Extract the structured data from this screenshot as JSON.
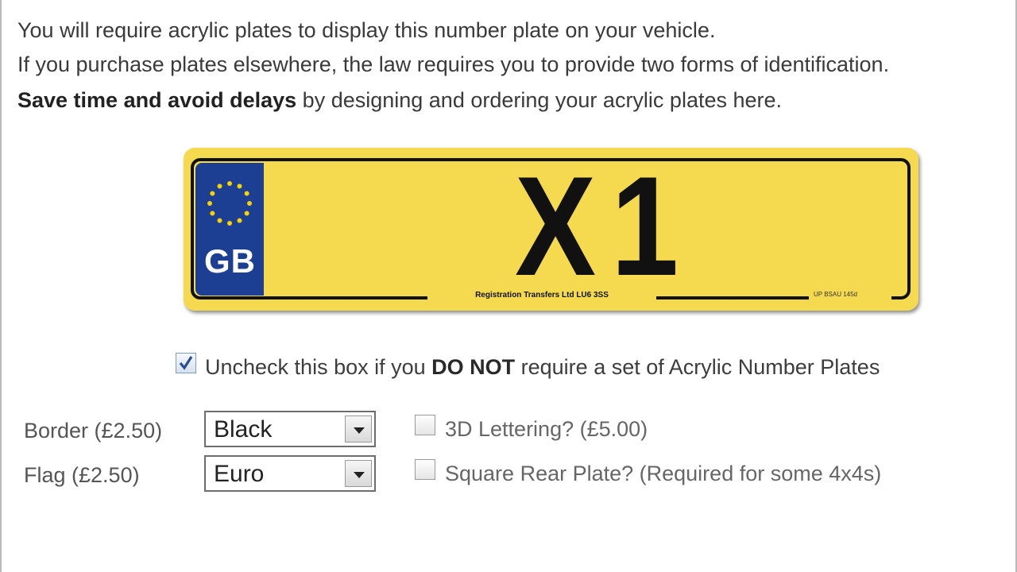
{
  "intro": {
    "line1": "You will require acrylic plates to display this number plate on your vehicle.",
    "line2": "If you purchase plates elsewhere, the law requires you to provide two forms of identification.",
    "line3_bold": "Save time and avoid delays",
    "line3_rest": " by designing and ordering your acrylic plates here."
  },
  "plate": {
    "registration": "X1",
    "country_code": "GB",
    "maker_text": "Registration Transfers Ltd LU6 3SS",
    "standard_text": "UP    BSAU 145d",
    "colors": {
      "background": "#f5da4f",
      "band": "#1c3f94",
      "stars": "#f5d300",
      "border": "#111111"
    },
    "flag_icon": "eu-stars-icon"
  },
  "acrylic_checkbox": {
    "checked": true,
    "label_pre": "Uncheck this box if you ",
    "label_bold": "DO NOT",
    "label_post": " require a set of Acrylic Number Plates"
  },
  "border": {
    "label": "Border (£2.50)",
    "value": "Black"
  },
  "flag": {
    "label": "Flag (£2.50)",
    "value": "Euro"
  },
  "lettering_3d": {
    "label": "3D Lettering? (£5.00)",
    "checked": false
  },
  "square_rear": {
    "label": "Square Rear Plate? (Required for some 4x4s)",
    "checked": false
  }
}
